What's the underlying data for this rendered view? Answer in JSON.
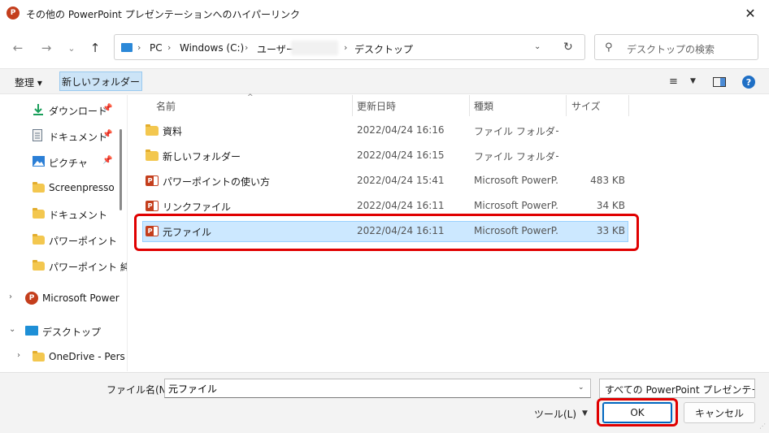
{
  "window": {
    "title": "その他の PowerPoint プレゼンテーションへのハイパーリンク",
    "app_icon_letter": "P",
    "close_glyph": "✕"
  },
  "nav": {
    "back_glyph": "←",
    "forward_glyph": "→",
    "recent_glyph": "⌄",
    "up_glyph": "↑",
    "breadcrumbs": [
      "PC",
      "Windows (C:)",
      "ユーザー",
      "デスクトップ"
    ],
    "crumb_separator": "›",
    "address_dropdown_glyph": "⌄",
    "refresh_glyph": "↻",
    "search_glyph": "⚲",
    "search_placeholder": "デスクトップの検索"
  },
  "toolbar": {
    "organize_label": "整理 ▾",
    "new_folder_label": "新しいフォルダー",
    "view_glyph": "≡",
    "dropdown_glyph": "▼",
    "help_glyph": "?"
  },
  "sidebar": {
    "pin_glyph": "📌",
    "items": [
      {
        "label": "ダウンロード",
        "icon": "download-icon",
        "pinned": true
      },
      {
        "label": "ドキュメント",
        "icon": "document-icon",
        "pinned": true
      },
      {
        "label": "ピクチャ",
        "icon": "picture-icon",
        "pinned": true
      },
      {
        "label": "Screenpresso",
        "icon": "folder-icon",
        "pinned": false
      },
      {
        "label": "ドキュメント",
        "icon": "folder-icon",
        "pinned": false
      },
      {
        "label": "パワーポイント",
        "icon": "folder-icon",
        "pinned": false
      },
      {
        "label": "パワーポイント 純",
        "icon": "folder-icon",
        "pinned": false
      },
      {
        "label": "Microsoft Power",
        "icon": "powerpoint-icon",
        "chevron": "›"
      },
      {
        "label": "デスクトップ",
        "icon": "desktop-icon",
        "chevron": "⌄"
      },
      {
        "label": "OneDrive - Pers",
        "icon": "folder-icon",
        "chevron": "›"
      }
    ]
  },
  "file_list": {
    "sort_glyph": "^",
    "columns": [
      "名前",
      "更新日時",
      "種類",
      "サイズ"
    ],
    "rows": [
      {
        "name": "資料",
        "date": "2022/04/24 16:16",
        "type": "ファイル フォルダー",
        "size": "",
        "icon": "folder-icon"
      },
      {
        "name": "新しいフォルダー",
        "date": "2022/04/24 16:15",
        "type": "ファイル フォルダー",
        "size": "",
        "icon": "folder-icon"
      },
      {
        "name": "パワーポイントの使い方",
        "date": "2022/04/24 15:41",
        "type": "Microsoft PowerP...",
        "size": "483 KB",
        "icon": "powerpoint-file-icon"
      },
      {
        "name": "リンクファイル",
        "date": "2022/04/24 16:11",
        "type": "Microsoft PowerP...",
        "size": "34 KB",
        "icon": "powerpoint-file-icon"
      },
      {
        "name": "元ファイル",
        "date": "2022/04/24 16:11",
        "type": "Microsoft PowerP...",
        "size": "33 KB",
        "icon": "powerpoint-file-icon",
        "selected": true
      }
    ]
  },
  "footer": {
    "filename_label": "ファイル名(N):",
    "filename_value": "元ファイル",
    "dropdown_glyph": "⌄",
    "filter_value": "すべての PowerPoint プレゼンテーション",
    "tools_label": "ツール(L)",
    "tools_glyph": "▼",
    "ok_label": "OK",
    "cancel_label": "キャンセル",
    "grip_glyph": "⋰"
  },
  "colors": {
    "selection_bg": "#cce8ff",
    "highlight_annotation": "#e00000",
    "folder": "#f3c74f",
    "powerpoint": "#c43e1c",
    "accent": "#0067c0"
  }
}
